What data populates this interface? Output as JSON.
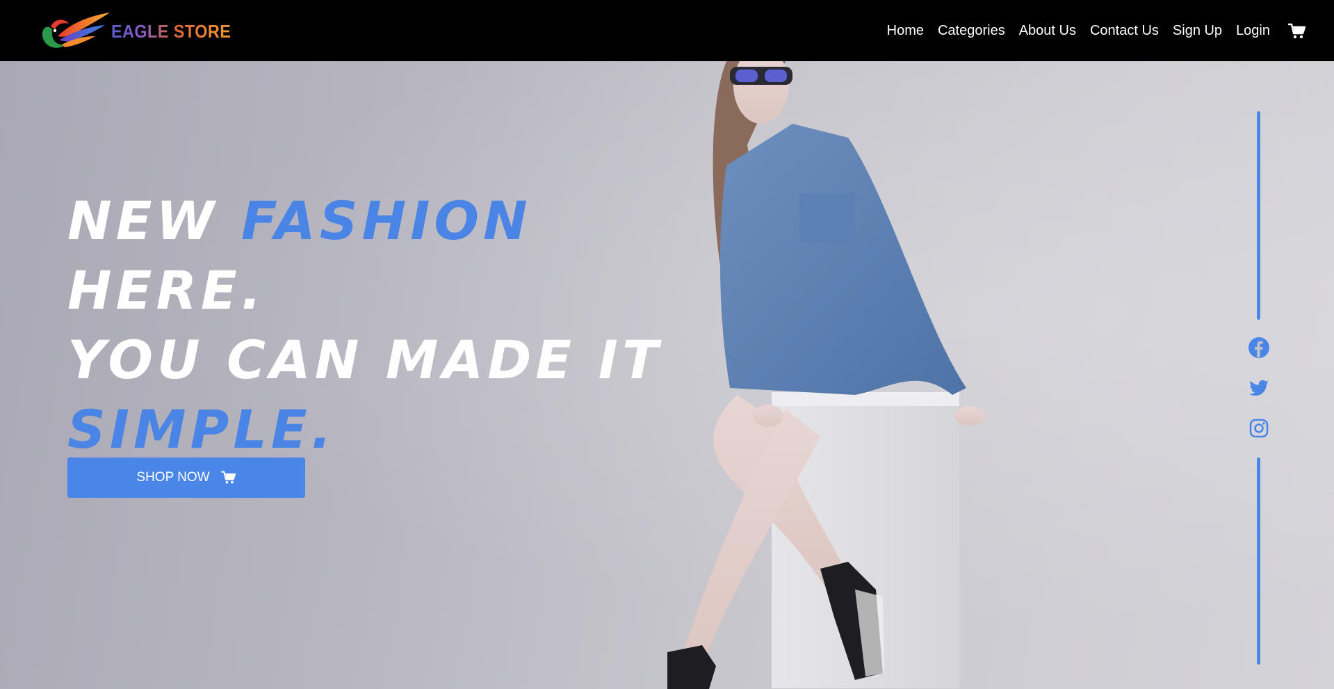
{
  "brand": {
    "name": "EAGLE STORE",
    "colors": {
      "accent": "#4a86e8",
      "nav_bg": "#000000",
      "logo_gradient": [
        "#5b5fc7",
        "#e0683a",
        "#f29a2e"
      ]
    }
  },
  "nav": {
    "items": [
      {
        "label": "Home"
      },
      {
        "label": "Categories"
      },
      {
        "label": "About Us"
      },
      {
        "label": "Contact Us"
      },
      {
        "label": "Sign Up"
      },
      {
        "label": "Login"
      }
    ],
    "cart_icon": "cart-icon"
  },
  "hero": {
    "line1_a": "New ",
    "line1_accent": "Fashion",
    "line1_b": " Here.",
    "line2": "You can made it",
    "line3_accent": "Simple.",
    "button_label": "SHOP NOW",
    "button_icon": "cart-icon"
  },
  "social": {
    "icons": [
      "facebook-icon",
      "twitter-icon",
      "instagram-icon"
    ]
  }
}
